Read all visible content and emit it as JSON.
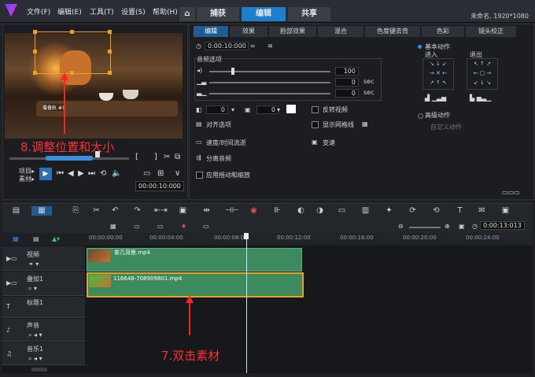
{
  "titlebar": {
    "menus": [
      "文件(F)",
      "编辑(E)",
      "工具(T)",
      "设置(S)",
      "帮助(H)"
    ],
    "home_tab": "⌂",
    "tabs": [
      "捕获",
      "编辑",
      "共享"
    ],
    "project_info": "未命名, 1920*1080"
  },
  "preview": {
    "overlay_label": "覆叠轨 #1",
    "annotation": "8.调整位置和大小",
    "mode_project": "项目▸",
    "mode_clip": "素材▸",
    "timecode": "00:00:10:000"
  },
  "options": {
    "tabs": [
      "编辑",
      "效果",
      "脸部效果",
      "混合",
      "色度键去背",
      "色彩",
      "镜头校正"
    ],
    "duration": "0:00:10:000",
    "audio_section": "音频选项",
    "volume": "100",
    "fade_in": "0",
    "fade_out": "0",
    "sec_unit": "sec",
    "rotate_value": "0",
    "border_value": "0",
    "reverse_video": "反转视频",
    "alignment": "对齐选项",
    "show_grid": "显示网格线",
    "speed": "速度/时间流逝",
    "variable_speed": "变速",
    "split_audio": "分离音频",
    "pan_zoom": "应用摇动和缩放",
    "basic_motion": "基本动作",
    "enter": "进入",
    "exit": "退出",
    "advanced_motion": "高级动作",
    "custom_motion": "自定义动作"
  },
  "timeline": {
    "timecode": "0:00:13:013",
    "ruler": [
      "00:00:00:00",
      "00:00:04:00",
      "00:00:08:00",
      "00:00:12:00",
      "00:00:16:00",
      "00:00:20:00",
      "00:00:24:00"
    ],
    "tracks": [
      {
        "name": "视频"
      },
      {
        "name": "叠加1"
      },
      {
        "name": "标题1"
      },
      {
        "name": "声音"
      },
      {
        "name": "音乐1"
      }
    ],
    "clips": {
      "video": "茶几背景.mp4",
      "overlay": "116648-708909801.mp4"
    },
    "annotation": "7.双击素材"
  },
  "colors": {
    "accent": "#1d7fd0",
    "clip_green": "#3d8a5e",
    "annotation_red": "#ff3030",
    "selection_orange": "#f0a020"
  }
}
